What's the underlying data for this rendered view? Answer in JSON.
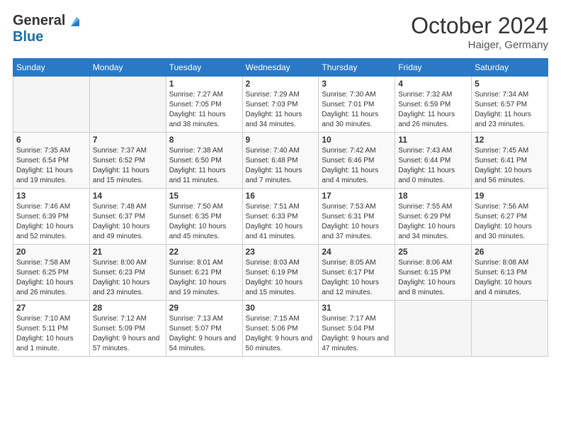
{
  "header": {
    "logo_general": "General",
    "logo_blue": "Blue",
    "month": "October 2024",
    "location": "Haiger, Germany"
  },
  "weekdays": [
    "Sunday",
    "Monday",
    "Tuesday",
    "Wednesday",
    "Thursday",
    "Friday",
    "Saturday"
  ],
  "weeks": [
    [
      {
        "day": "",
        "info": ""
      },
      {
        "day": "",
        "info": ""
      },
      {
        "day": "1",
        "info": "Sunrise: 7:27 AM\nSunset: 7:05 PM\nDaylight: 11 hours and 38 minutes."
      },
      {
        "day": "2",
        "info": "Sunrise: 7:29 AM\nSunset: 7:03 PM\nDaylight: 11 hours and 34 minutes."
      },
      {
        "day": "3",
        "info": "Sunrise: 7:30 AM\nSunset: 7:01 PM\nDaylight: 11 hours and 30 minutes."
      },
      {
        "day": "4",
        "info": "Sunrise: 7:32 AM\nSunset: 6:59 PM\nDaylight: 11 hours and 26 minutes."
      },
      {
        "day": "5",
        "info": "Sunrise: 7:34 AM\nSunset: 6:57 PM\nDaylight: 11 hours and 23 minutes."
      }
    ],
    [
      {
        "day": "6",
        "info": "Sunrise: 7:35 AM\nSunset: 6:54 PM\nDaylight: 11 hours and 19 minutes."
      },
      {
        "day": "7",
        "info": "Sunrise: 7:37 AM\nSunset: 6:52 PM\nDaylight: 11 hours and 15 minutes."
      },
      {
        "day": "8",
        "info": "Sunrise: 7:38 AM\nSunset: 6:50 PM\nDaylight: 11 hours and 11 minutes."
      },
      {
        "day": "9",
        "info": "Sunrise: 7:40 AM\nSunset: 6:48 PM\nDaylight: 11 hours and 7 minutes."
      },
      {
        "day": "10",
        "info": "Sunrise: 7:42 AM\nSunset: 6:46 PM\nDaylight: 11 hours and 4 minutes."
      },
      {
        "day": "11",
        "info": "Sunrise: 7:43 AM\nSunset: 6:44 PM\nDaylight: 11 hours and 0 minutes."
      },
      {
        "day": "12",
        "info": "Sunrise: 7:45 AM\nSunset: 6:41 PM\nDaylight: 10 hours and 56 minutes."
      }
    ],
    [
      {
        "day": "13",
        "info": "Sunrise: 7:46 AM\nSunset: 6:39 PM\nDaylight: 10 hours and 52 minutes."
      },
      {
        "day": "14",
        "info": "Sunrise: 7:48 AM\nSunset: 6:37 PM\nDaylight: 10 hours and 49 minutes."
      },
      {
        "day": "15",
        "info": "Sunrise: 7:50 AM\nSunset: 6:35 PM\nDaylight: 10 hours and 45 minutes."
      },
      {
        "day": "16",
        "info": "Sunrise: 7:51 AM\nSunset: 6:33 PM\nDaylight: 10 hours and 41 minutes."
      },
      {
        "day": "17",
        "info": "Sunrise: 7:53 AM\nSunset: 6:31 PM\nDaylight: 10 hours and 37 minutes."
      },
      {
        "day": "18",
        "info": "Sunrise: 7:55 AM\nSunset: 6:29 PM\nDaylight: 10 hours and 34 minutes."
      },
      {
        "day": "19",
        "info": "Sunrise: 7:56 AM\nSunset: 6:27 PM\nDaylight: 10 hours and 30 minutes."
      }
    ],
    [
      {
        "day": "20",
        "info": "Sunrise: 7:58 AM\nSunset: 6:25 PM\nDaylight: 10 hours and 26 minutes."
      },
      {
        "day": "21",
        "info": "Sunrise: 8:00 AM\nSunset: 6:23 PM\nDaylight: 10 hours and 23 minutes."
      },
      {
        "day": "22",
        "info": "Sunrise: 8:01 AM\nSunset: 6:21 PM\nDaylight: 10 hours and 19 minutes."
      },
      {
        "day": "23",
        "info": "Sunrise: 8:03 AM\nSunset: 6:19 PM\nDaylight: 10 hours and 15 minutes."
      },
      {
        "day": "24",
        "info": "Sunrise: 8:05 AM\nSunset: 6:17 PM\nDaylight: 10 hours and 12 minutes."
      },
      {
        "day": "25",
        "info": "Sunrise: 8:06 AM\nSunset: 6:15 PM\nDaylight: 10 hours and 8 minutes."
      },
      {
        "day": "26",
        "info": "Sunrise: 8:08 AM\nSunset: 6:13 PM\nDaylight: 10 hours and 4 minutes."
      }
    ],
    [
      {
        "day": "27",
        "info": "Sunrise: 7:10 AM\nSunset: 5:11 PM\nDaylight: 10 hours and 1 minute."
      },
      {
        "day": "28",
        "info": "Sunrise: 7:12 AM\nSunset: 5:09 PM\nDaylight: 9 hours and 57 minutes."
      },
      {
        "day": "29",
        "info": "Sunrise: 7:13 AM\nSunset: 5:07 PM\nDaylight: 9 hours and 54 minutes."
      },
      {
        "day": "30",
        "info": "Sunrise: 7:15 AM\nSunset: 5:06 PM\nDaylight: 9 hours and 50 minutes."
      },
      {
        "day": "31",
        "info": "Sunrise: 7:17 AM\nSunset: 5:04 PM\nDaylight: 9 hours and 47 minutes."
      },
      {
        "day": "",
        "info": ""
      },
      {
        "day": "",
        "info": ""
      }
    ]
  ]
}
